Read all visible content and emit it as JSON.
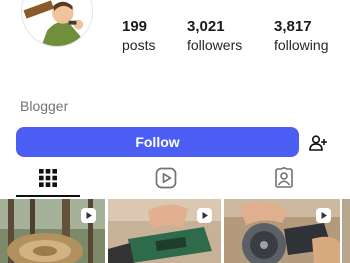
{
  "profile": {
    "bio": "Blogger",
    "stats": [
      {
        "value": "199",
        "label": "posts"
      },
      {
        "value": "3,021",
        "label": "followers"
      },
      {
        "value": "3,817",
        "label": "following"
      }
    ]
  },
  "actions": {
    "follow_label": "Follow",
    "add_icon": "add-user-icon"
  },
  "tabs": [
    {
      "icon": "grid-icon",
      "active": true
    },
    {
      "icon": "reels-icon",
      "active": false
    },
    {
      "icon": "tagged-icon",
      "active": false
    }
  ],
  "colors": {
    "accent": "#4d5ef5",
    "muted_text": "#737373"
  }
}
